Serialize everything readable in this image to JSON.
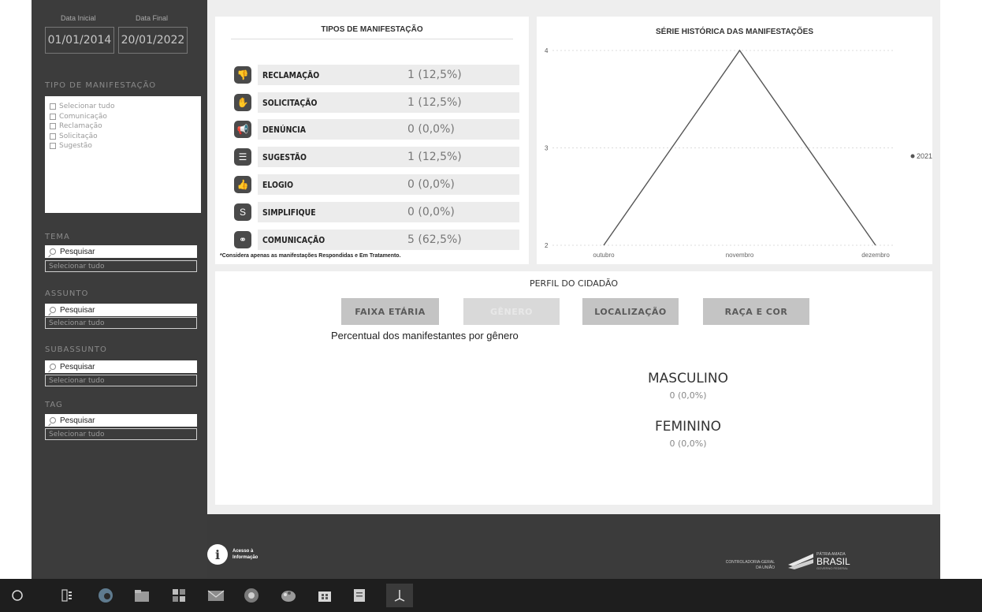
{
  "filters": {
    "date_start_label": "Data Inicial",
    "date_end_label": "Data Final",
    "date_start": "01/01/2014",
    "date_end": "20/01/2022",
    "tipo_title": "TIPO DE MANIFESTAÇÃO",
    "tipo_options": [
      "Selecionar tudo",
      "Comunicação",
      "Reclamação",
      "Solicitação",
      "Sugestão"
    ],
    "tema_title": "TEMA",
    "assunto_title": "ASSUNTO",
    "subassunto_title": "SUBASSUNTO",
    "tag_title": "TAG",
    "search_placeholder": "Pesquisar",
    "select_all": "Selecionar tudo"
  },
  "tipos": {
    "title": "TIPOS DE MANIFESTAÇÃO",
    "rows": [
      {
        "label": "RECLAMAÇÃO",
        "value": "1 (12,5%)",
        "icon": "thumbs-down-icon"
      },
      {
        "label": "SOLICITAÇÃO",
        "value": "1 (12,5%)",
        "icon": "hand-icon"
      },
      {
        "label": "DENÚNCIA",
        "value": "0 (0,0%)",
        "icon": "megaphone-icon"
      },
      {
        "label": "SUGESTÃO",
        "value": "1 (12,5%)",
        "icon": "note-icon"
      },
      {
        "label": "ELOGIO",
        "value": "0 (0,0%)",
        "icon": "thumbs-up-icon"
      },
      {
        "label": "SIMPLIFIQUE",
        "value": "0 (0,0%)",
        "icon": "simplifique-icon"
      },
      {
        "label": "COMUNICAÇÃO",
        "value": "5 (62,5%)",
        "icon": "comunicacao-icon"
      }
    ],
    "note": "*Considera apenas as manifestações Respondidas e Em Tratamento."
  },
  "serie": {
    "title": "SÉRIE HISTÓRICA DAS MANIFESTAÇÕES",
    "legend": "2021"
  },
  "chart_data": {
    "type": "line",
    "title": "SÉRIE HISTÓRICA DAS MANIFESTAÇÕES",
    "categories": [
      "outubro",
      "novembro",
      "dezembro"
    ],
    "series": [
      {
        "name": "2021",
        "values": [
          2,
          4,
          2
        ]
      }
    ],
    "yticks": [
      2,
      3,
      4
    ],
    "ylim": [
      2,
      4
    ],
    "grid": true,
    "legend_position": "right"
  },
  "perfil": {
    "title": "PERFIL DO CIDADÃO",
    "buttons": [
      "FAIXA ETÁRIA",
      "GÊNERO",
      "LOCALIZAÇÃO",
      "RAÇA E COR"
    ],
    "subtitle": "Percentual dos manifestantes por gênero",
    "masc_label": "MASCULINO",
    "masc_value": "0 (0,0%)",
    "fem_label": "FEMININO",
    "fem_value": "0 (0,0%)"
  },
  "footer": {
    "info_text_1": "Acesso à",
    "info_text_2": "Informação",
    "cgu_1": "CONTROLADORIA-GERAL",
    "cgu_2": "DA UNIÃO",
    "patria": "PÁTRIA AMADA",
    "brasil": "BRASIL",
    "gov": "GOVERNO FEDERAL"
  },
  "colors": {
    "sidebar": "#3c3c3c",
    "footer": "#3b3b3b",
    "taskbar": "#1e1e1e"
  }
}
